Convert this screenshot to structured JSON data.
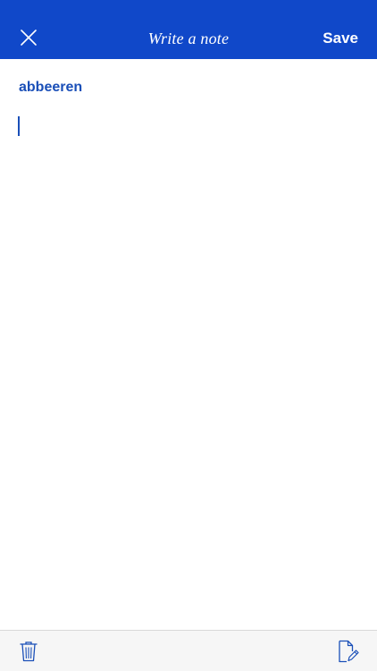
{
  "nav": {
    "title": "Write a note",
    "save_label": "Save",
    "close_icon": "close-icon"
  },
  "note": {
    "heading": "abbeeren",
    "body": ""
  },
  "toolbar": {
    "left_icon": "trash-icon",
    "right_icon": "compose-icon"
  },
  "colors": {
    "nav_background": "#1048c9",
    "accent": "#1a4fb8",
    "toolbar_background": "#f6f6f6"
  }
}
